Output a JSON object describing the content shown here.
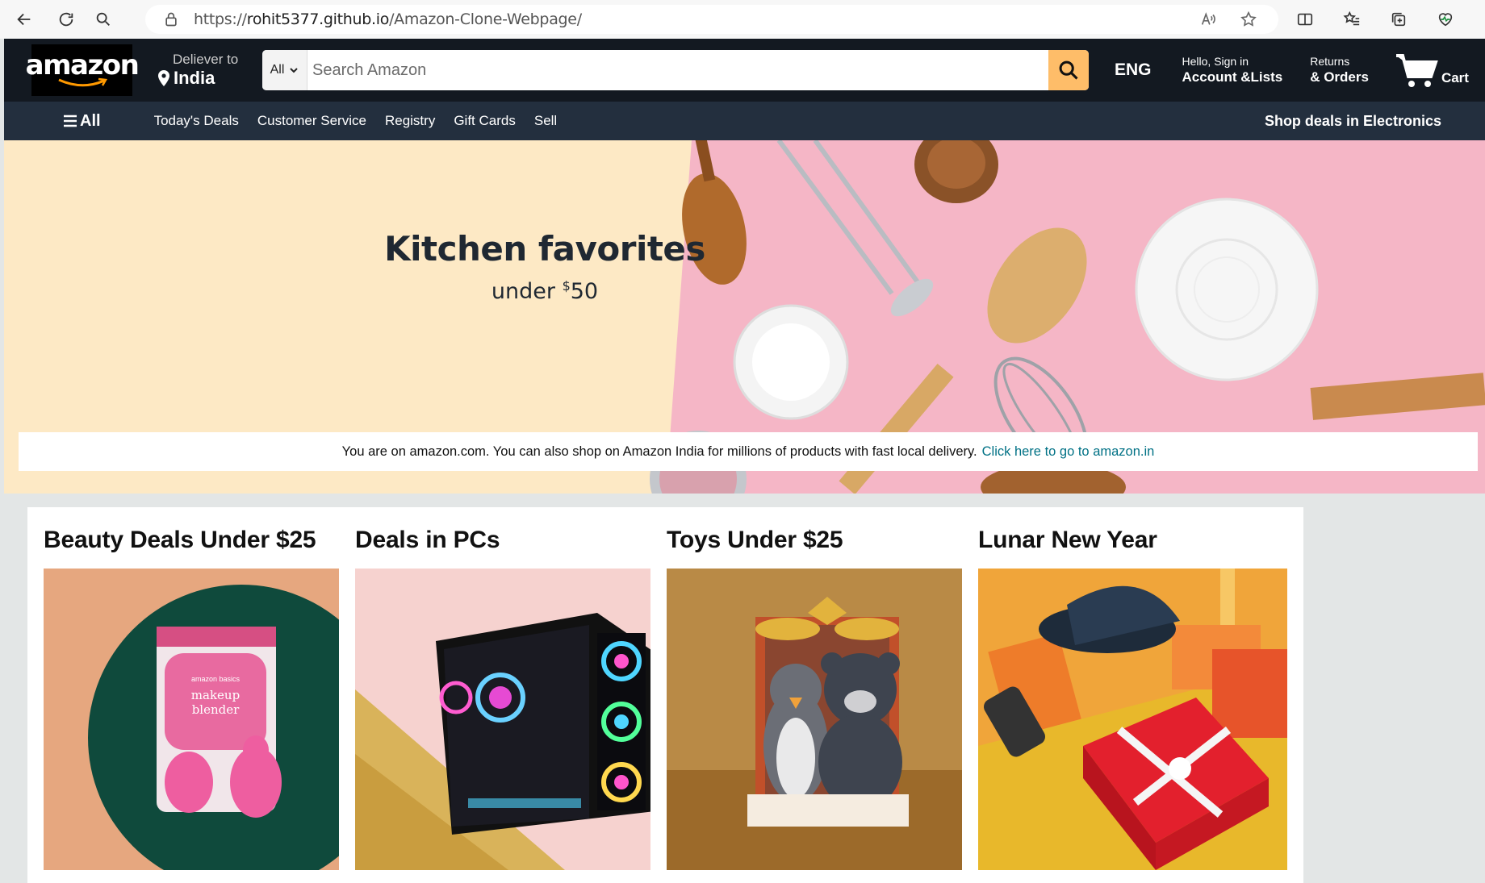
{
  "browser": {
    "url_prefix": "https://",
    "url_host": "rohit5377.github.io",
    "url_path": "/Amazon-Clone-Webpage/"
  },
  "header": {
    "logo_text": "amazon",
    "deliver_label": "Deliever to",
    "deliver_location": "India",
    "search_category": "All",
    "search_placeholder": "Search Amazon",
    "language": "ENG",
    "account_greeting": "Hello, Sign in",
    "account_label": "Account &Lists",
    "returns_label": "Returns",
    "orders_label": "& Orders",
    "cart_label": "Cart"
  },
  "subnav": {
    "all_label": "All",
    "links": [
      "Today's Deals",
      "Customer Service",
      "Registry",
      "Gift Cards",
      "Sell"
    ],
    "promo": "Shop deals in Electronics"
  },
  "hero": {
    "title": "Kitchen favorites",
    "subtitle_prefix": "under ",
    "currency": "$",
    "price": "50",
    "notice_text": "You are on amazon.com. You can also shop on Amazon India for millions of products with fast local delivery.",
    "notice_link": "Click here to go to amazon.in"
  },
  "cards": [
    {
      "title": "Beauty Deals Under $25",
      "image": "makeup-blender-image",
      "image_text_1": "amazon basics",
      "image_text_2": "makeup",
      "image_text_3": "blender"
    },
    {
      "title": "Deals in PCs",
      "image": "gaming-pc-image"
    },
    {
      "title": "Toys Under $25",
      "image": "plush-toys-image"
    },
    {
      "title": "Lunar New Year",
      "image": "gift-box-image"
    }
  ],
  "colors": {
    "header_bg": "#131921",
    "subnav_bg": "#232f3e",
    "search_button": "#febd69",
    "link": "#007185",
    "hero_bg": "#fde9c5",
    "hero_pink": "#f5b6c6"
  }
}
